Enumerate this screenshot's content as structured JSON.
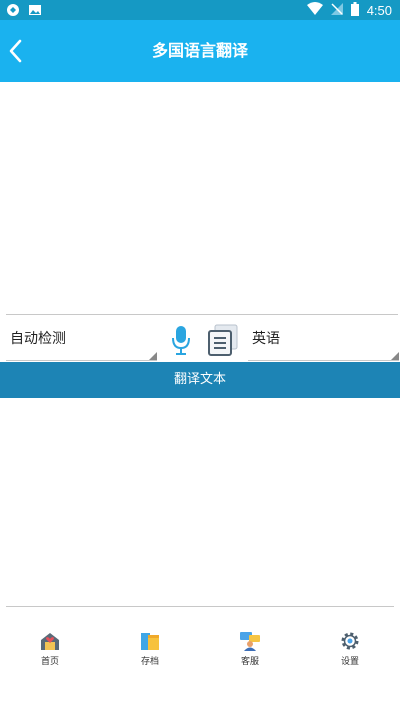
{
  "status_bar": {
    "time": "4:50"
  },
  "app_bar": {
    "title": "多国语言翻译"
  },
  "source": {
    "text": ""
  },
  "languages": {
    "source": "自动检测",
    "target": "英语"
  },
  "translate_button": {
    "label": "翻译文本"
  },
  "result": {
    "text": ""
  },
  "bottom_nav": {
    "items": [
      {
        "label": "首页",
        "icon": "home-icon"
      },
      {
        "label": "存档",
        "icon": "archive-folder-icon"
      },
      {
        "label": "客服",
        "icon": "customer-service-icon"
      },
      {
        "label": "设置",
        "icon": "gear-icon"
      }
    ]
  },
  "colors": {
    "status_bar": "#1599c4",
    "app_bar": "#1ab2ef",
    "translate_button": "#1d84b5",
    "mic": "#2aa5e0"
  }
}
